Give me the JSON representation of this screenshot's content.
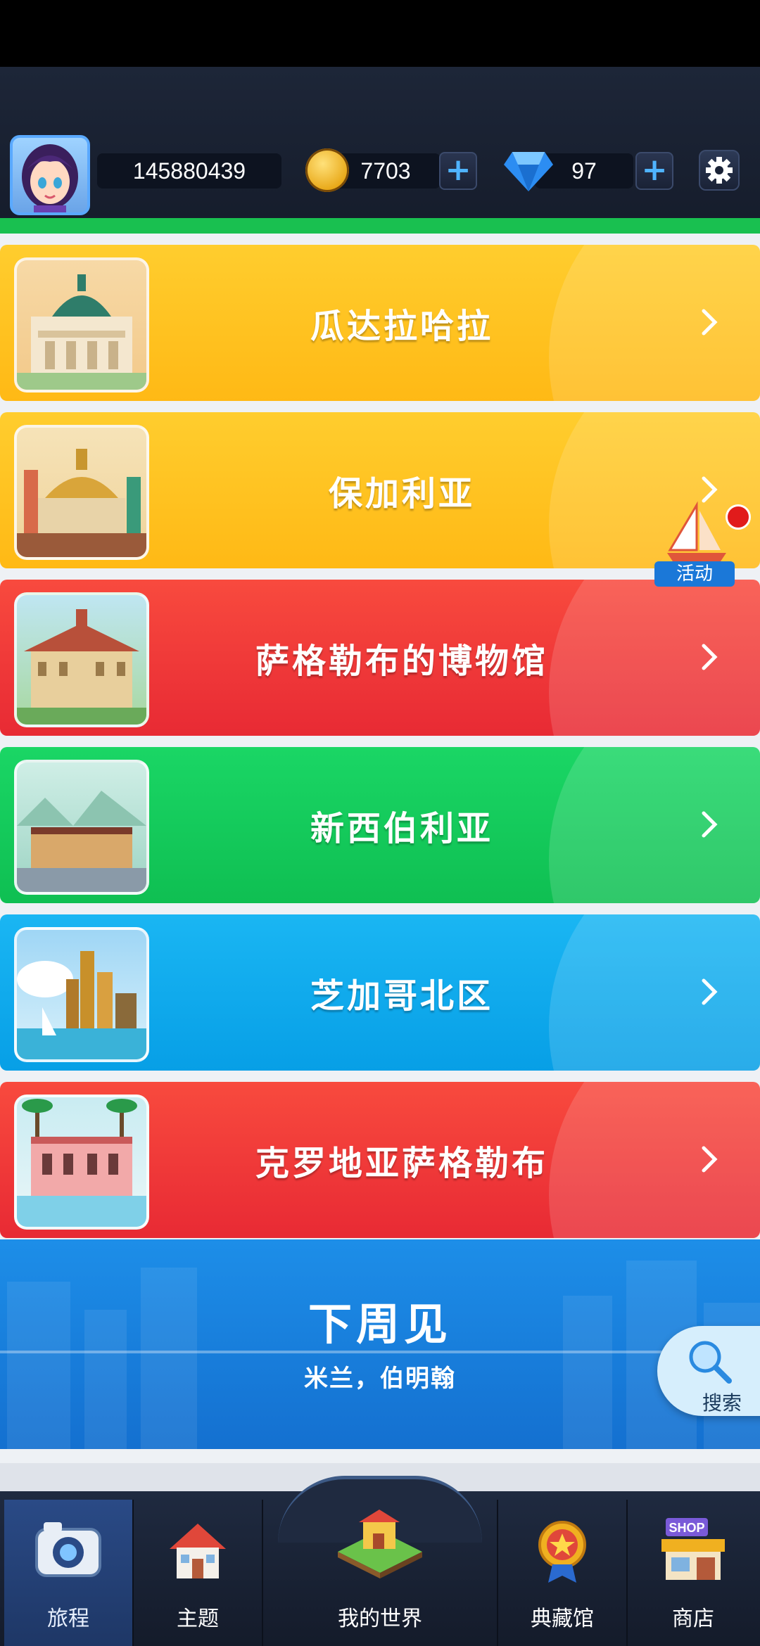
{
  "header": {
    "player_id": "145880439",
    "coins": "7703",
    "gems": "97"
  },
  "destinations": [
    {
      "name": "瓜达拉哈拉",
      "color": "#ffc21a"
    },
    {
      "name": "保加利亚",
      "color": "#ffc21a"
    },
    {
      "name": "萨格勒布的博物馆",
      "color": "#f0393a"
    },
    {
      "name": "新西伯利亚",
      "color": "#14c85a"
    },
    {
      "name": "芝加哥北区",
      "color": "#10a9ec"
    },
    {
      "name": "克罗地亚萨格勒布",
      "color": "#f0393a"
    }
  ],
  "next_week": {
    "title": "下周见",
    "subtitle": "米兰，伯明翰"
  },
  "activity_label": "活动",
  "search_label": "搜索",
  "nav": {
    "journey": "旅程",
    "theme": "主题",
    "my_world": "我的世界",
    "collection": "典藏馆",
    "shop": "商店"
  }
}
